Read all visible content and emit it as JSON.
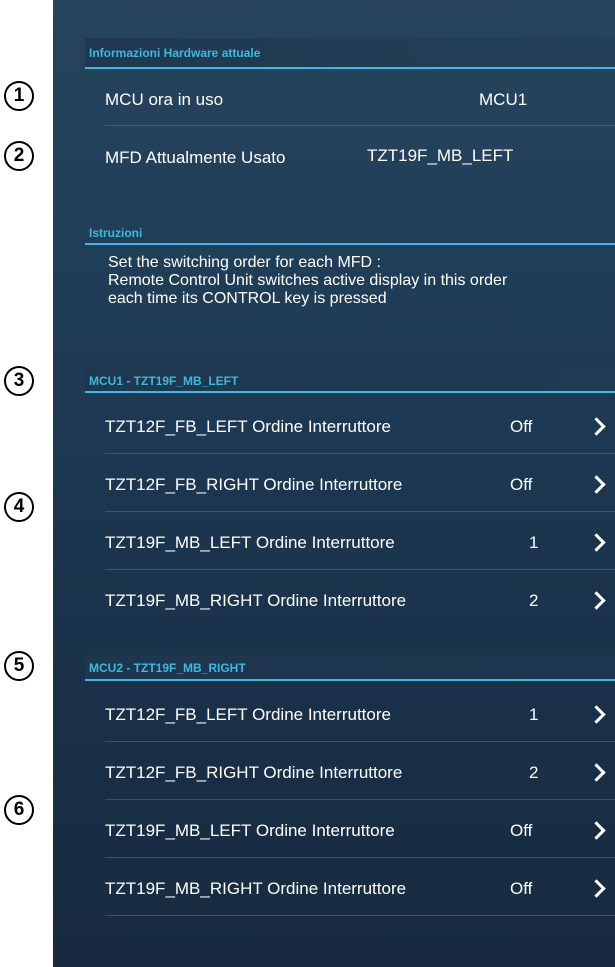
{
  "hardware": {
    "title": "Informazioni Hardware attuale",
    "mcu_label": "MCU ora in uso",
    "mcu_value": "MCU1",
    "mfd_label": "MFD Attualmente Usato",
    "mfd_value": "TZT19F_MB_LEFT"
  },
  "instructions": {
    "title": "Istruzioni",
    "line1": "Set the switching order for each MFD :",
    "line2": "Remote Control Unit switches active display in this order",
    "line3": "each time its CONTROL key is pressed"
  },
  "mcu1": {
    "title": "MCU1 - TZT19F_MB_LEFT",
    "items": [
      {
        "name": "TZT12F_FB_LEFT",
        "label": "Ordine Interruttore",
        "value": "Off"
      },
      {
        "name": "TZT12F_FB_RIGHT",
        "label": "Ordine Interruttore",
        "value": "Off"
      },
      {
        "name": "TZT19F_MB_LEFT",
        "label": "Ordine Interruttore",
        "value": "1"
      },
      {
        "name": "TZT19F_MB_RIGHT",
        "label": "Ordine Interruttore",
        "value": "2"
      }
    ]
  },
  "mcu2": {
    "title": "MCU2 - TZT19F_MB_RIGHT",
    "items": [
      {
        "name": "TZT12F_FB_LEFT",
        "label": "Ordine Interruttore",
        "value": "1"
      },
      {
        "name": "TZT12F_FB_RIGHT",
        "label": "Ordine Interruttore",
        "value": "2"
      },
      {
        "name": "TZT19F_MB_LEFT",
        "label": "Ordine Interruttore",
        "value": "Off"
      },
      {
        "name": "TZT19F_MB_RIGHT",
        "label": "Ordine Interruttore",
        "value": "Off"
      }
    ]
  },
  "callouts": [
    "1",
    "2",
    "3",
    "4",
    "5",
    "6"
  ]
}
